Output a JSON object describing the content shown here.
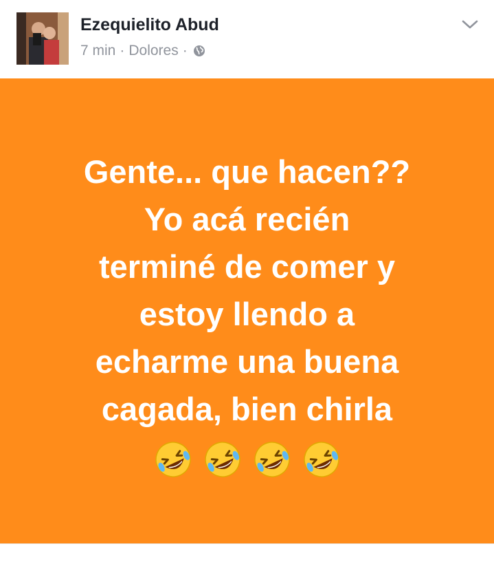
{
  "post": {
    "author": "Ezequielito Abud",
    "time": "7 min",
    "separator": "·",
    "location": "Dolores",
    "separator2": "·",
    "privacy_icon": "globe-icon",
    "menu_icon": "chevron-down-icon"
  },
  "status": {
    "lines": [
      "Gente... que hacen??",
      "Yo acá recién",
      "terminé de comer y",
      "estoy llendo a",
      "echarme una buena",
      "cagada, bien chirla"
    ],
    "emoji": [
      "🤣",
      "🤣",
      "🤣",
      "🤣"
    ],
    "background_color": "#ff8c1a",
    "text_color": "#ffffff"
  }
}
